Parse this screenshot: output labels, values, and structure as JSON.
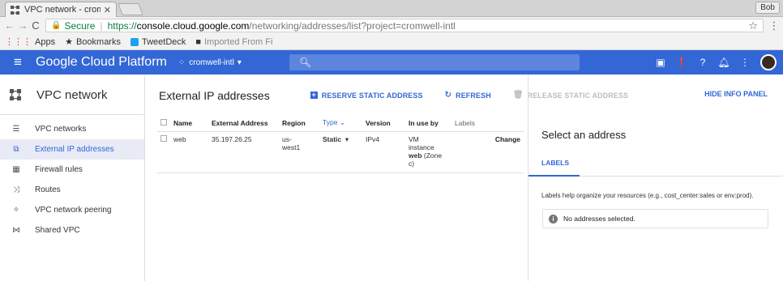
{
  "browser": {
    "tab_title": "VPC network - crom",
    "window_user": "Bob",
    "secure_label": "Secure",
    "url_scheme": "https://",
    "url_host": "console.cloud.google.com",
    "url_path": "/networking/addresses/list?project=cromwell-intl",
    "bookmarks": [
      {
        "label": "Apps",
        "icon": "apps-icon"
      },
      {
        "label": "Bookmarks",
        "icon": "star-icon"
      },
      {
        "label": "TweetDeck",
        "icon": "tweetdeck-icon"
      },
      {
        "label": "Imported From Fi",
        "icon": "folder-icon"
      }
    ]
  },
  "gcp": {
    "product": "Google Cloud Platform",
    "project": "cromwell-intl",
    "accent": "#3367d6"
  },
  "sidebar": {
    "title": "VPC network",
    "items": [
      {
        "label": "VPC networks",
        "icon": "vpc-networks-icon"
      },
      {
        "label": "External IP addresses",
        "icon": "external-ip-icon"
      },
      {
        "label": "Firewall rules",
        "icon": "firewall-icon"
      },
      {
        "label": "Routes",
        "icon": "routes-icon"
      },
      {
        "label": "VPC network peering",
        "icon": "peering-icon"
      },
      {
        "label": "Shared VPC",
        "icon": "shared-vpc-icon"
      }
    ]
  },
  "toolbar": {
    "title": "External IP addresses",
    "reserve": "RESERVE STATIC ADDRESS",
    "refresh": "REFRESH",
    "release": "RELEASE STATIC ADDRESS",
    "hide_panel": "HIDE INFO PANEL"
  },
  "table": {
    "headers": [
      "Name",
      "External Address",
      "Region",
      "Type",
      "Version",
      "In use by",
      "Labels"
    ],
    "rows": [
      {
        "name": "web",
        "address": "35.197.26.25",
        "region_1": "us-",
        "region_2": "west1",
        "type": "Static",
        "version": "IPv4",
        "inuse_1": "VM",
        "inuse_2": "instance",
        "inuse_3": "web",
        "inuse_4": "(Zone",
        "inuse_5": "c)",
        "action": "Change"
      }
    ]
  },
  "info_panel": {
    "title": "Select an address",
    "tab": "LABELS",
    "help": "Labels help organize your resources (e.g., cost_center:sales or env:prod).",
    "notice": "No addresses selected."
  }
}
